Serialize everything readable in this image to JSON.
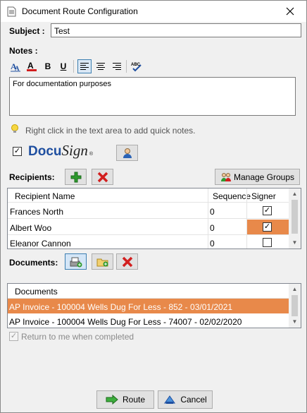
{
  "window": {
    "title": "Document Route Configuration"
  },
  "subject": {
    "label": "Subject :",
    "value": "Test"
  },
  "notes": {
    "label": "Notes :",
    "text": "For documentation purposes",
    "hint": "Right click in the text area to add quick notes.",
    "toolbar": {
      "bold": "B",
      "underline": "U",
      "spell": "ABC"
    }
  },
  "docusign": {
    "checked": true,
    "logo_docu": "Docu",
    "logo_sign": "Sign",
    "logo_mark": "®"
  },
  "recipients": {
    "label": "Recipients:",
    "manage_groups": "Manage Groups",
    "columns": [
      "Recipient Name",
      "Sequence",
      "Signer"
    ],
    "rows": [
      {
        "name": "Frances North",
        "sequence": "0",
        "signer": true,
        "selected": false
      },
      {
        "name": "Albert Woo",
        "sequence": "0",
        "signer": true,
        "selected": true
      },
      {
        "name": "Eleanor Cannon",
        "sequence": "0",
        "signer": false,
        "selected": false
      }
    ]
  },
  "documents": {
    "label": "Documents:",
    "column": "Documents",
    "rows": [
      {
        "name": "AP Invoice - 100004 Wells Dug For Less - 852 - 03/01/2021",
        "selected": true
      },
      {
        "name": "AP Invoice - 100004 Wells Dug For Less - 74007 - 02/02/2020",
        "selected": false
      }
    ]
  },
  "return_to_me": {
    "label": "Return to me when completed",
    "checked": true,
    "enabled": false
  },
  "buttons": {
    "route": "Route",
    "cancel": "Cancel"
  },
  "colors": {
    "selection": "#e8894a",
    "accent_green": "#2e9a2e",
    "accent_red": "#d21e1e",
    "docusign_blue": "#1f4fa0"
  }
}
